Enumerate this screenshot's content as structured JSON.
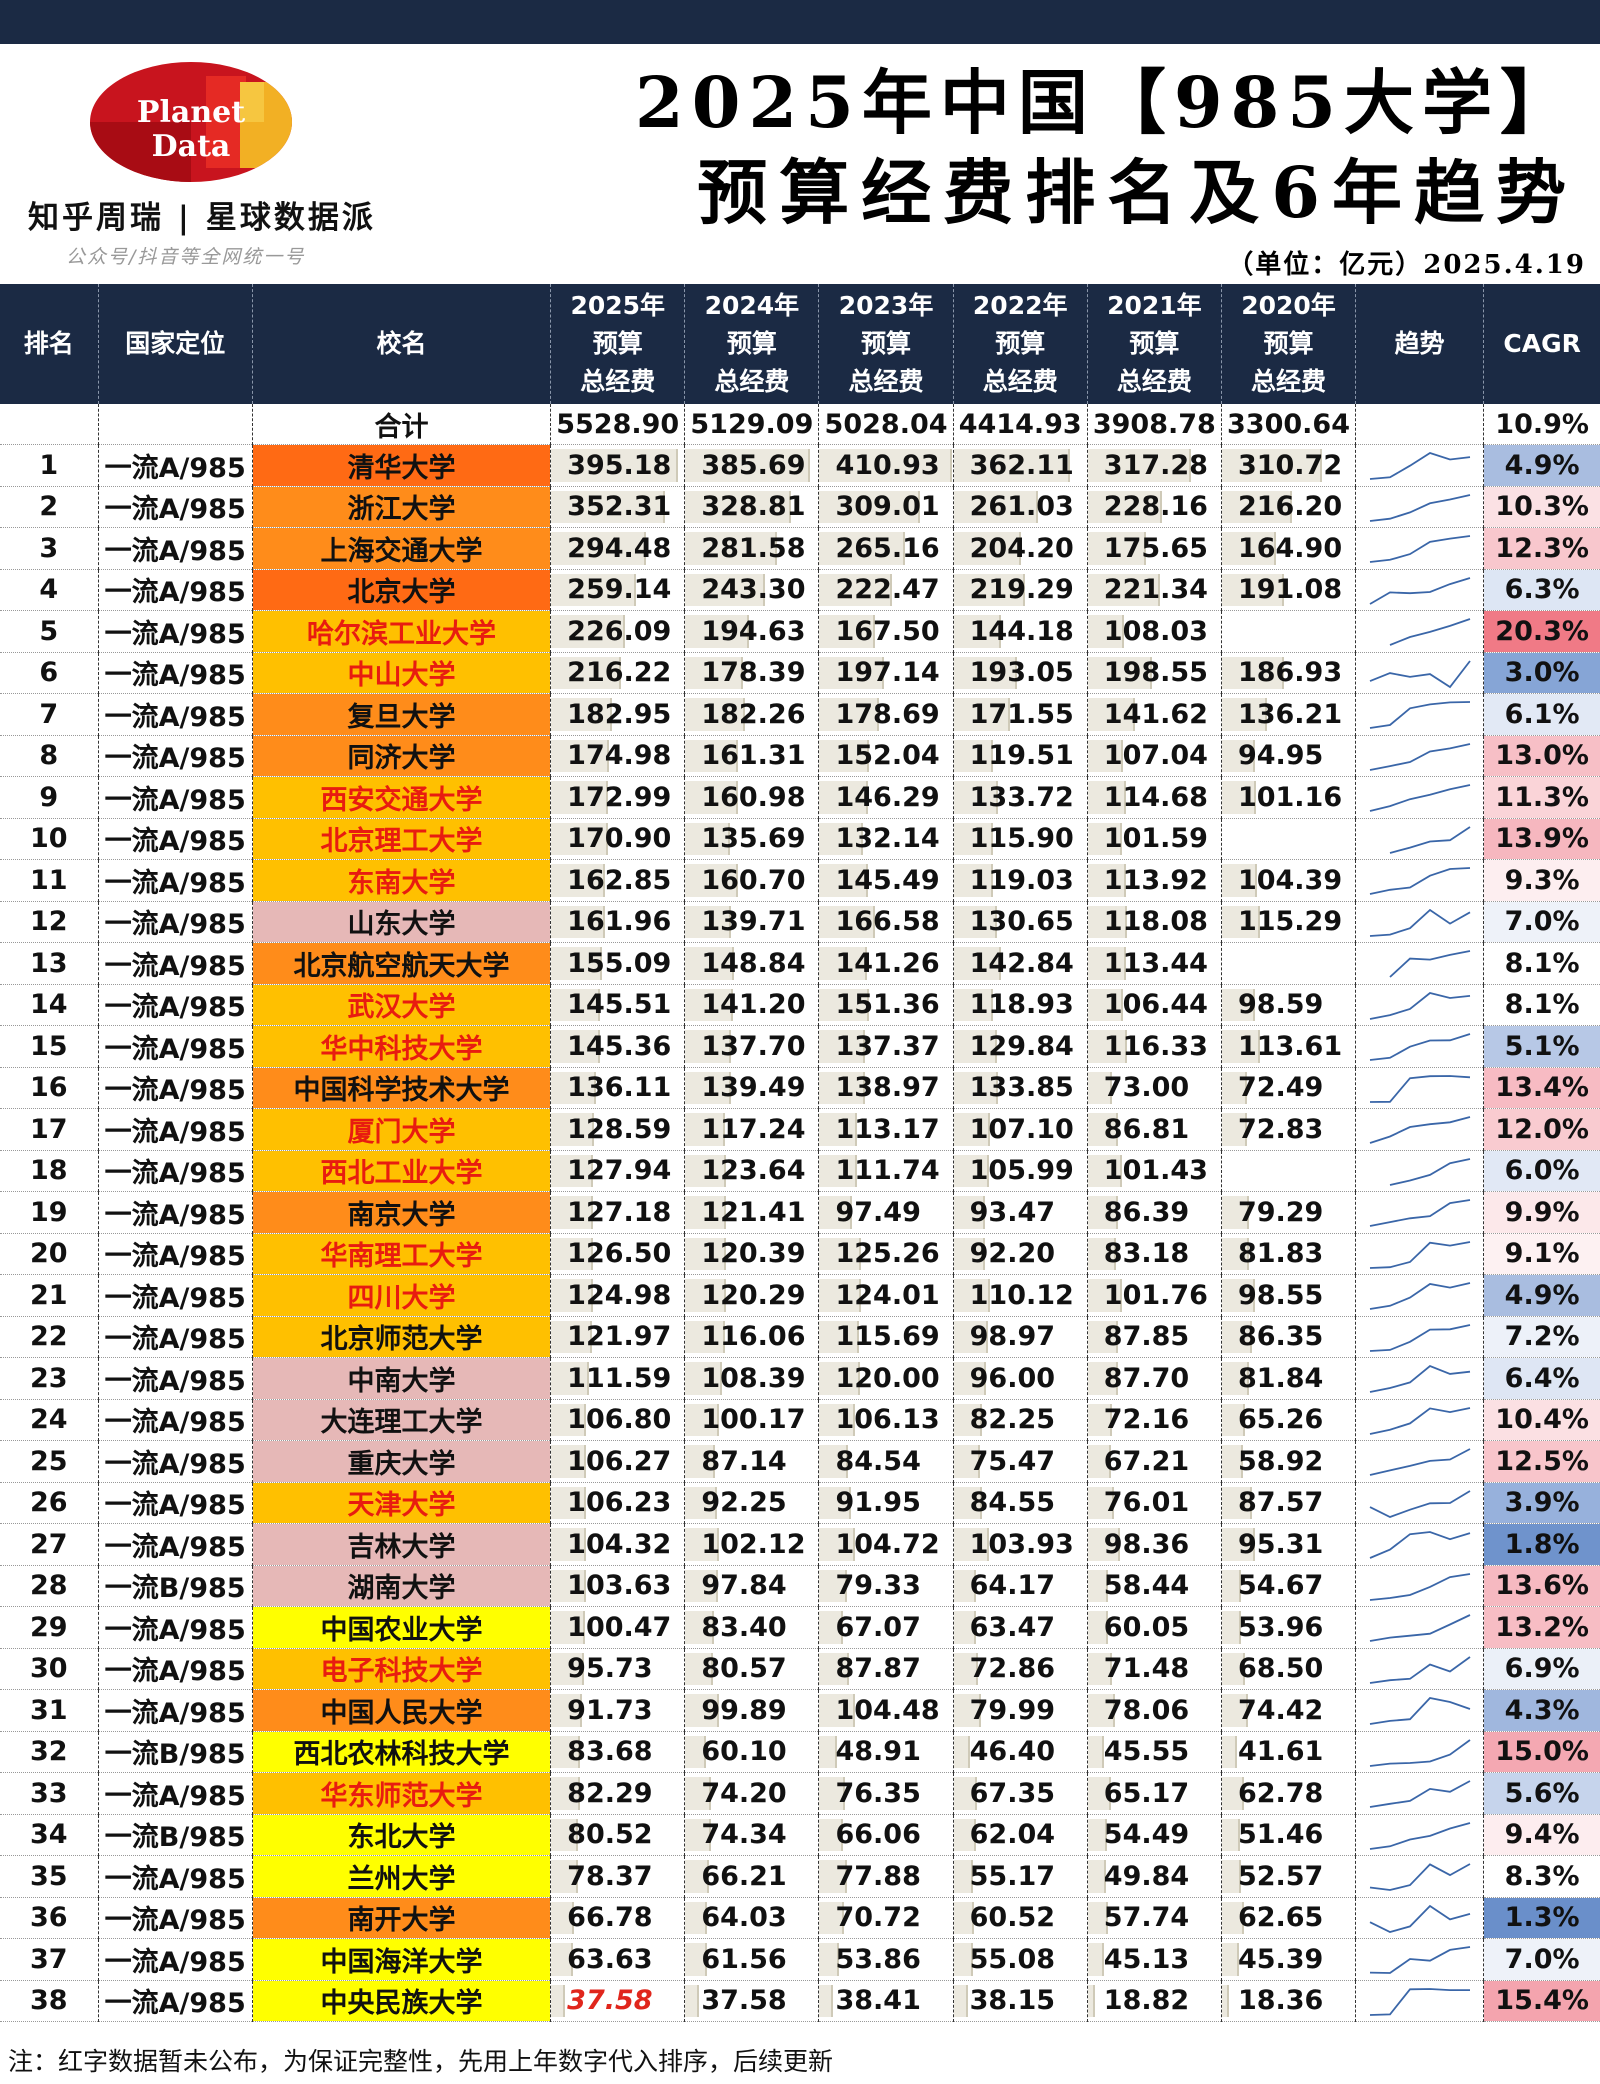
{
  "header": {
    "logo_line1": "Planet",
    "logo_line2": "Data",
    "brand": "知乎周瑞 | 星球数据派",
    "brand_sub": "公众号/抖音等全网统一号",
    "title_line1": "2025年中国【985大学】",
    "title_line2": "预算经费排名及6年趋势",
    "unit_line": "（单位：亿元）2025.4.19"
  },
  "columns": {
    "rank": "排名",
    "position": "国家定位",
    "name": "校名",
    "y2025": [
      "2025年",
      "预算",
      "总经费"
    ],
    "y2024": [
      "2024年",
      "预算",
      "总经费"
    ],
    "y2023": [
      "2023年",
      "预算",
      "总经费"
    ],
    "y2022": [
      "2022年",
      "预算",
      "总经费"
    ],
    "y2021": [
      "2021年",
      "预算",
      "总经费"
    ],
    "y2020": [
      "2020年",
      "预算",
      "总经费"
    ],
    "trend": "趋势",
    "cagr": "CAGR"
  },
  "total": {
    "label": "合计",
    "values": [
      "5528.90",
      "5129.09",
      "5028.04",
      "4414.93",
      "3908.78",
      "3300.64"
    ],
    "cagr": "10.9%"
  },
  "rows": [
    {
      "rank": "1",
      "pos": "一流A/985",
      "name": "清华大学",
      "bg": "#ff6a14",
      "red": false,
      "v": [
        "395.18",
        "385.69",
        "410.93",
        "362.11",
        "317.28",
        "310.72"
      ],
      "est": false,
      "cagr": "4.9%",
      "cbg": "#a9bde0",
      "flag": false
    },
    {
      "rank": "2",
      "pos": "一流A/985",
      "name": "浙江大学",
      "bg": "#ff8c1a",
      "red": false,
      "v": [
        "352.31",
        "328.81",
        "309.01",
        "261.03",
        "228.16",
        "216.20"
      ],
      "est": false,
      "cagr": "10.3%",
      "cbg": "#fbe1e4",
      "flag": false
    },
    {
      "rank": "3",
      "pos": "一流A/985",
      "name": "上海交通大学",
      "bg": "#ff8c1a",
      "red": false,
      "v": [
        "294.48",
        "281.58",
        "265.16",
        "204.20",
        "175.65",
        "164.90"
      ],
      "est": false,
      "cagr": "12.3%",
      "cbg": "#f8c7cd",
      "flag": false
    },
    {
      "rank": "4",
      "pos": "一流A/985",
      "name": "北京大学",
      "bg": "#ff6a14",
      "red": false,
      "v": [
        "259.14",
        "243.30",
        "222.47",
        "219.29",
        "221.34",
        "191.08"
      ],
      "est": false,
      "cagr": "6.3%",
      "cbg": "#dde6f4",
      "flag": false
    },
    {
      "rank": "5",
      "pos": "一流A/985",
      "name": "哈尔滨工业大学",
      "bg": "#ffc000",
      "red": true,
      "v": [
        "226.09",
        "194.63",
        "167.50",
        "144.18",
        "108.03",
        ""
      ],
      "est": false,
      "cagr": "20.3%",
      "cbg": "#f07a86",
      "flag": true
    },
    {
      "rank": "6",
      "pos": "一流A/985",
      "name": "中山大学",
      "bg": "#ffc000",
      "red": true,
      "v": [
        "216.22",
        "178.39",
        "197.14",
        "193.05",
        "198.55",
        "186.93"
      ],
      "est": false,
      "cagr": "3.0%",
      "cbg": "#86a5d6",
      "flag": false
    },
    {
      "rank": "7",
      "pos": "一流A/985",
      "name": "复旦大学",
      "bg": "#ff8c1a",
      "red": false,
      "v": [
        "182.95",
        "182.26",
        "178.69",
        "171.55",
        "141.62",
        "136.21"
      ],
      "est": false,
      "cagr": "6.1%",
      "cbg": "#e2e9f5",
      "flag": false
    },
    {
      "rank": "8",
      "pos": "一流A/985",
      "name": "同济大学",
      "bg": "#ff8c1a",
      "red": false,
      "v": [
        "174.98",
        "161.31",
        "152.04",
        "119.51",
        "107.04",
        "94.95"
      ],
      "est": false,
      "cagr": "13.0%",
      "cbg": "#f7bfc6",
      "flag": false
    },
    {
      "rank": "9",
      "pos": "一流A/985",
      "name": "西安交通大学",
      "bg": "#ffc000",
      "red": true,
      "v": [
        "172.99",
        "160.98",
        "146.29",
        "133.72",
        "114.68",
        "101.16"
      ],
      "est": false,
      "cagr": "11.3%",
      "cbg": "#fad4d8",
      "flag": false
    },
    {
      "rank": "10",
      "pos": "一流A/985",
      "name": "北京理工大学",
      "bg": "#ffc000",
      "red": true,
      "v": [
        "170.90",
        "135.69",
        "132.14",
        "115.90",
        "101.59",
        ""
      ],
      "est": false,
      "cagr": "13.9%",
      "cbg": "#f6b7bf",
      "flag": true
    },
    {
      "rank": "11",
      "pos": "一流A/985",
      "name": "东南大学",
      "bg": "#ffc000",
      "red": true,
      "v": [
        "162.85",
        "160.70",
        "145.49",
        "119.03",
        "113.92",
        "104.39"
      ],
      "est": false,
      "cagr": "9.3%",
      "cbg": "#fdeef0",
      "flag": false
    },
    {
      "rank": "12",
      "pos": "一流A/985",
      "name": "山东大学",
      "bg": "#e6b8b7",
      "red": false,
      "v": [
        "161.96",
        "139.71",
        "166.58",
        "130.65",
        "118.08",
        "115.29"
      ],
      "est": false,
      "cagr": "7.0%",
      "cbg": "#eef2f9",
      "flag": false
    },
    {
      "rank": "13",
      "pos": "一流A/985",
      "name": "北京航空航天大学",
      "bg": "#ff8c1a",
      "red": false,
      "v": [
        "155.09",
        "148.84",
        "141.26",
        "142.84",
        "113.44",
        ""
      ],
      "est": false,
      "cagr": "8.1%",
      "cbg": "#ffffff",
      "flag": true
    },
    {
      "rank": "14",
      "pos": "一流A/985",
      "name": "武汉大学",
      "bg": "#ffc000",
      "red": true,
      "v": [
        "145.51",
        "141.20",
        "151.36",
        "118.93",
        "106.44",
        "98.59"
      ],
      "est": false,
      "cagr": "8.1%",
      "cbg": "#ffffff",
      "flag": false
    },
    {
      "rank": "15",
      "pos": "一流A/985",
      "name": "华中科技大学",
      "bg": "#ffc000",
      "red": true,
      "v": [
        "145.36",
        "137.70",
        "137.37",
        "129.84",
        "116.33",
        "113.61"
      ],
      "est": false,
      "cagr": "5.1%",
      "cbg": "#b7c8e6",
      "flag": false
    },
    {
      "rank": "16",
      "pos": "一流A/985",
      "name": "中国科学技术大学",
      "bg": "#ff8c1a",
      "red": false,
      "v": [
        "136.11",
        "139.49",
        "138.97",
        "133.85",
        "73.00",
        "72.49"
      ],
      "est": false,
      "cagr": "13.4%",
      "cbg": "#f7bbc3",
      "flag": false
    },
    {
      "rank": "17",
      "pos": "一流A/985",
      "name": "厦门大学",
      "bg": "#ffc000",
      "red": true,
      "v": [
        "128.59",
        "117.24",
        "113.17",
        "107.10",
        "86.81",
        "72.83"
      ],
      "est": false,
      "cagr": "12.0%",
      "cbg": "#f9cbd0",
      "flag": false
    },
    {
      "rank": "18",
      "pos": "一流A/985",
      "name": "西北工业大学",
      "bg": "#ffc000",
      "red": true,
      "v": [
        "127.94",
        "123.64",
        "111.74",
        "105.99",
        "101.43",
        ""
      ],
      "est": false,
      "cagr": "6.0%",
      "cbg": "#e1e8f5",
      "flag": true
    },
    {
      "rank": "19",
      "pos": "一流A/985",
      "name": "南京大学",
      "bg": "#ff8c1a",
      "red": false,
      "v": [
        "127.18",
        "121.41",
        "97.49",
        "93.47",
        "86.39",
        "79.29"
      ],
      "est": false,
      "cagr": "9.9%",
      "cbg": "#fce8ea",
      "flag": false
    },
    {
      "rank": "20",
      "pos": "一流A/985",
      "name": "华南理工大学",
      "bg": "#ffc000",
      "red": true,
      "v": [
        "126.50",
        "120.39",
        "125.26",
        "92.20",
        "83.18",
        "81.83"
      ],
      "est": false,
      "cagr": "9.1%",
      "cbg": "#fdf1f2",
      "flag": false
    },
    {
      "rank": "21",
      "pos": "一流A/985",
      "name": "四川大学",
      "bg": "#ffc000",
      "red": true,
      "v": [
        "124.98",
        "120.29",
        "124.01",
        "110.12",
        "101.76",
        "98.55"
      ],
      "est": false,
      "cagr": "4.9%",
      "cbg": "#a9bde0",
      "flag": false
    },
    {
      "rank": "22",
      "pos": "一流A/985",
      "name": "北京师范大学",
      "bg": "#ffc000",
      "red": false,
      "v": [
        "121.97",
        "116.06",
        "115.69",
        "98.97",
        "87.85",
        "86.35"
      ],
      "est": false,
      "cagr": "7.2%",
      "cbg": "#edf1f9",
      "flag": false
    },
    {
      "rank": "23",
      "pos": "一流A/985",
      "name": "中南大学",
      "bg": "#e6b8b7",
      "red": false,
      "v": [
        "111.59",
        "108.39",
        "120.00",
        "96.00",
        "87.70",
        "81.84"
      ],
      "est": false,
      "cagr": "6.4%",
      "cbg": "#dee6f4",
      "flag": false
    },
    {
      "rank": "24",
      "pos": "一流A/985",
      "name": "大连理工大学",
      "bg": "#e6b8b7",
      "red": false,
      "v": [
        "106.80",
        "100.17",
        "106.13",
        "82.25",
        "72.16",
        "65.26"
      ],
      "est": false,
      "cagr": "10.4%",
      "cbg": "#fbe0e3",
      "flag": false
    },
    {
      "rank": "25",
      "pos": "一流A/985",
      "name": "重庆大学",
      "bg": "#e6b8b7",
      "red": false,
      "v": [
        "106.27",
        "87.14",
        "84.54",
        "75.47",
        "67.21",
        "58.92"
      ],
      "est": false,
      "cagr": "12.5%",
      "cbg": "#f8c5cb",
      "flag": false
    },
    {
      "rank": "26",
      "pos": "一流A/985",
      "name": "天津大学",
      "bg": "#ffc000",
      "red": true,
      "v": [
        "106.23",
        "92.25",
        "91.95",
        "84.55",
        "76.01",
        "87.57"
      ],
      "est": false,
      "cagr": "3.9%",
      "cbg": "#97b1dc",
      "flag": false
    },
    {
      "rank": "27",
      "pos": "一流A/985",
      "name": "吉林大学",
      "bg": "#e6b8b7",
      "red": false,
      "v": [
        "104.32",
        "102.12",
        "104.72",
        "103.93",
        "98.36",
        "95.31"
      ],
      "est": false,
      "cagr": "1.8%",
      "cbg": "#6f93cc",
      "flag": false
    },
    {
      "rank": "28",
      "pos": "一流B/985",
      "name": "湖南大学",
      "bg": "#e6b8b7",
      "red": false,
      "v": [
        "103.63",
        "97.84",
        "79.33",
        "64.17",
        "58.44",
        "54.67"
      ],
      "est": false,
      "cagr": "13.6%",
      "cbg": "#f6b9c1",
      "flag": false
    },
    {
      "rank": "29",
      "pos": "一流A/985",
      "name": "中国农业大学",
      "bg": "#ffff00",
      "red": false,
      "v": [
        "100.47",
        "83.40",
        "67.07",
        "63.47",
        "60.05",
        "53.96"
      ],
      "est": false,
      "cagr": "13.2%",
      "cbg": "#f7bdc4",
      "flag": false
    },
    {
      "rank": "30",
      "pos": "一流A/985",
      "name": "电子科技大学",
      "bg": "#ffc000",
      "red": true,
      "v": [
        "95.73",
        "80.57",
        "87.87",
        "72.86",
        "71.48",
        "68.50"
      ],
      "est": false,
      "cagr": "6.9%",
      "cbg": "#ebf0f8",
      "flag": false
    },
    {
      "rank": "31",
      "pos": "一流A/985",
      "name": "中国人民大学",
      "bg": "#ff8c1a",
      "red": false,
      "v": [
        "91.73",
        "99.89",
        "104.48",
        "79.99",
        "78.06",
        "74.42"
      ],
      "est": false,
      "cagr": "4.3%",
      "cbg": "#a0b7de",
      "flag": false
    },
    {
      "rank": "32",
      "pos": "一流B/985",
      "name": "西北农林科技大学",
      "bg": "#ffff00",
      "red": false,
      "v": [
        "83.68",
        "60.10",
        "48.91",
        "46.40",
        "45.55",
        "41.61"
      ],
      "est": false,
      "cagr": "15.0%",
      "cbg": "#f4a8b2",
      "flag": false
    },
    {
      "rank": "33",
      "pos": "一流A/985",
      "name": "华东师范大学",
      "bg": "#ffc000",
      "red": true,
      "v": [
        "82.29",
        "74.20",
        "76.35",
        "67.35",
        "65.17",
        "62.78"
      ],
      "est": false,
      "cagr": "5.6%",
      "cbg": "#c6d4ec",
      "flag": false
    },
    {
      "rank": "34",
      "pos": "一流B/985",
      "name": "东北大学",
      "bg": "#ffff00",
      "red": false,
      "v": [
        "80.52",
        "74.34",
        "66.06",
        "62.04",
        "54.49",
        "51.46"
      ],
      "est": false,
      "cagr": "9.4%",
      "cbg": "#fdedef",
      "flag": false
    },
    {
      "rank": "35",
      "pos": "一流A/985",
      "name": "兰州大学",
      "bg": "#ffff00",
      "red": false,
      "v": [
        "78.37",
        "66.21",
        "77.88",
        "55.17",
        "49.84",
        "52.57"
      ],
      "est": false,
      "cagr": "8.3%",
      "cbg": "#ffffff",
      "flag": false
    },
    {
      "rank": "36",
      "pos": "一流A/985",
      "name": "南开大学",
      "bg": "#ff8c1a",
      "red": false,
      "v": [
        "66.78",
        "64.03",
        "70.72",
        "60.52",
        "57.74",
        "62.65"
      ],
      "est": false,
      "cagr": "1.3%",
      "cbg": "#6a8fca",
      "flag": false
    },
    {
      "rank": "37",
      "pos": "一流A/985",
      "name": "中国海洋大学",
      "bg": "#ffff00",
      "red": false,
      "v": [
        "63.63",
        "61.56",
        "53.86",
        "55.08",
        "45.13",
        "45.39"
      ],
      "est": false,
      "cagr": "7.0%",
      "cbg": "#eef2f9",
      "flag": false
    },
    {
      "rank": "38",
      "pos": "一流A/985",
      "name": "中央民族大学",
      "bg": "#ffff00",
      "red": false,
      "v": [
        "37.58",
        "37.58",
        "38.41",
        "38.15",
        "18.82",
        "18.36"
      ],
      "est": true,
      "cagr": "15.4%",
      "cbg": "#f4a4ae",
      "flag": false
    }
  ],
  "note": "注：红字数据暂未公布，为保证完整性，先用上年数字代入排序，后续更新",
  "colors": {
    "header_bg": "#1b2a44",
    "trend_line": "#3a66a8",
    "bar_fill": "#ece9df"
  }
}
